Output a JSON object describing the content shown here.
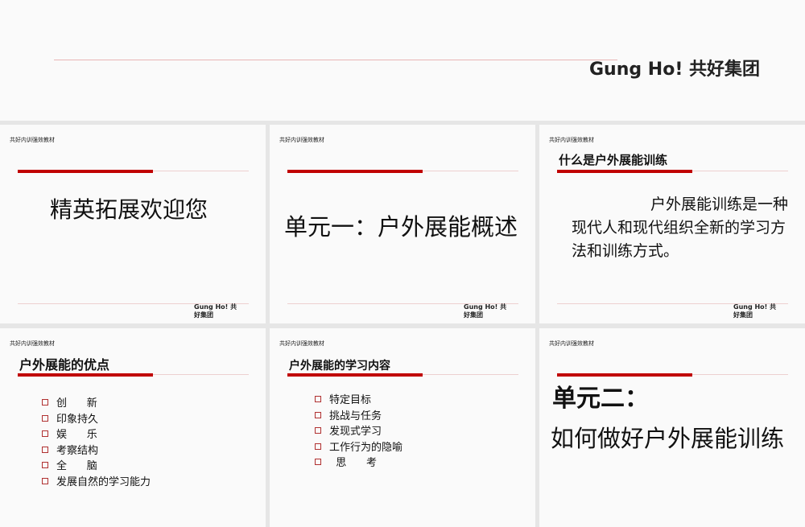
{
  "top_slide": {
    "brand": "Gung Ho!  共好集团"
  },
  "common": {
    "header": "共好内训强效教材",
    "footer": "Gung Ho!  共好集团"
  },
  "slides": [
    {
      "title": "精英拓展欢迎您"
    },
    {
      "title": "单元一：户外展能概述"
    },
    {
      "heading": "什么是户外展能训练",
      "body": "户外展能训练是一种现代人和现代组织全新的学习方法和训练方式。"
    },
    {
      "heading": "户外展能的优点",
      "items": [
        "创      新",
        "印象持久",
        "娱      乐",
        "考察结构",
        "全      脑",
        "发展自然的学习能力"
      ]
    },
    {
      "heading": "户外展能的学习内容",
      "items": [
        "特定目标",
        "挑战与任务",
        "发现式学习",
        "工作行为的隐喻",
        "  思      考"
      ]
    },
    {
      "title_line1": "单元二：",
      "title_line2": "如何做好户外展能训练"
    }
  ]
}
